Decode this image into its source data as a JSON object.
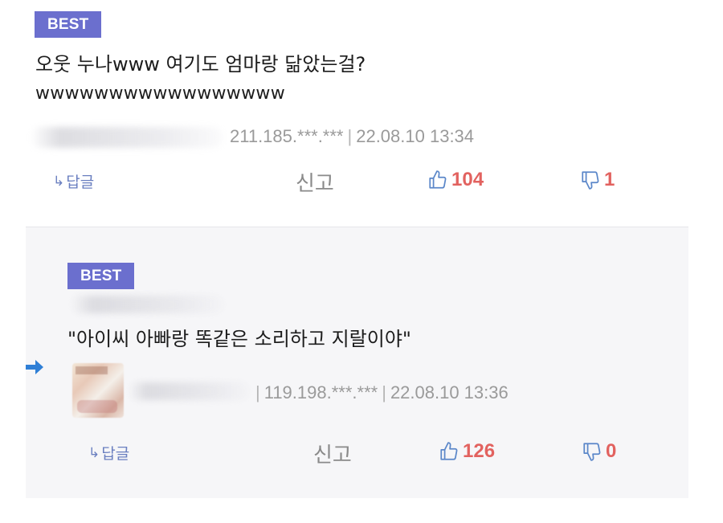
{
  "colors": {
    "badge": "#6b6fce",
    "like": "#e2625f",
    "reply_link": "#6a7fc0",
    "meta": "#9a9a9a"
  },
  "comment": {
    "badge": "BEST",
    "line1": "오웃 누나www 여기도 엄마랑 닮았는걸?",
    "line2": "wwwwwwwwwwwwwwwww",
    "ip": "211.185.***.***",
    "date": "22.08.10 13:34",
    "reply_label": "답글",
    "report_label": "신고",
    "likes": "104",
    "dislikes": "1"
  },
  "reply": {
    "badge": "BEST",
    "text": "\"아이씨 아빠랑 똑같은 소리하고 지랄이야\"",
    "ip": "119.198.***.***",
    "date": "22.08.10 13:36",
    "reply_label": "답글",
    "report_label": "신고",
    "likes": "126",
    "dislikes": "0"
  },
  "icons": {
    "reply_arrow": "reply-arrow-icon",
    "thumbs_up": "thumbs-up-icon",
    "thumbs_down": "thumbs-down-icon",
    "pointer": "right-arrow-icon"
  }
}
